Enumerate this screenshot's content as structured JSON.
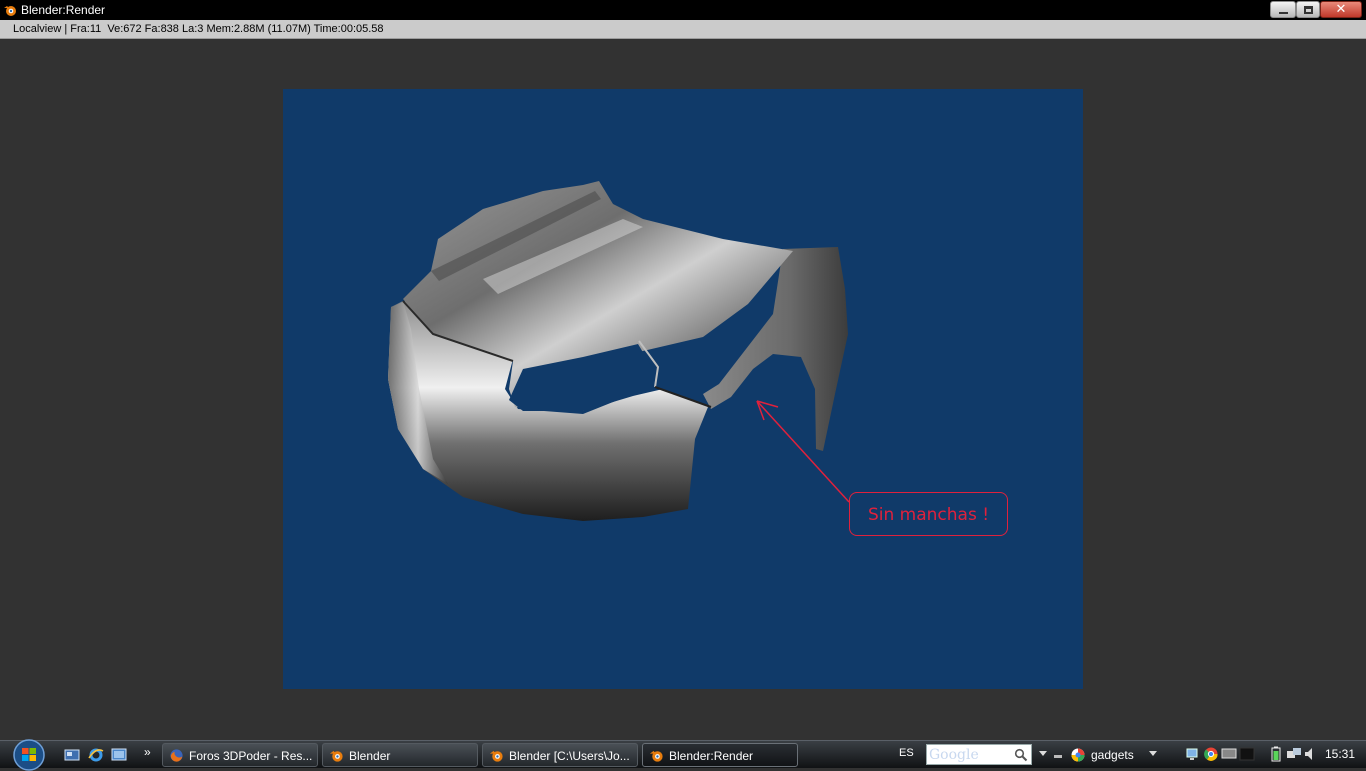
{
  "window": {
    "title": "Blender:Render"
  },
  "infobar": {
    "text": "Localview | Fra:11  Ve:672 Fa:838 La:3 Mem:2.88M (11.07M) Time:00:05.58"
  },
  "annotation": {
    "text": "Sin manchas !",
    "color": "#e0213c"
  },
  "colors": {
    "render_background": "#103a69",
    "app_background": "#323232"
  },
  "taskbar": {
    "quicklaunch_more": "»",
    "tasks": [
      {
        "label": "Foros 3DPoder - Res...",
        "icon": "firefox-icon"
      },
      {
        "label": "Blender",
        "icon": "blender-icon"
      },
      {
        "label": "Blender [C:\\Users\\Jo...",
        "icon": "blender-icon"
      },
      {
        "label": "Blender:Render",
        "icon": "blender-icon"
      }
    ],
    "language": "ES",
    "search_value": "Google",
    "gadgets_label": "gadgets",
    "clock": "15:31"
  }
}
